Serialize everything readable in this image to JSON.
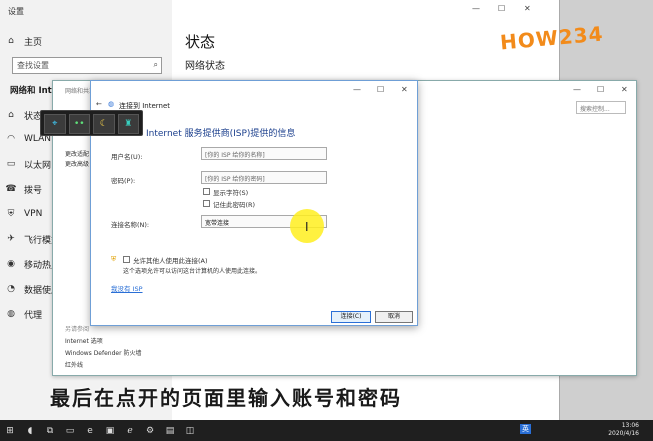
{
  "settings": {
    "title": "设置",
    "home": "主页",
    "search_placeholder": "查找设置",
    "section": "网络和 Internet",
    "nav": [
      {
        "label": "状态",
        "icon": "home-icon"
      },
      {
        "label": "WLAN",
        "icon": "wifi-icon"
      },
      {
        "label": "以太网",
        "icon": "ethernet-icon"
      },
      {
        "label": "拨号",
        "icon": "dialup-icon"
      },
      {
        "label": "VPN",
        "icon": "vpn-icon"
      },
      {
        "label": "飞行模式",
        "icon": "airplane-icon"
      },
      {
        "label": "移动热点",
        "icon": "hotspot-icon"
      },
      {
        "label": "数据使用量",
        "icon": "data-usage-icon"
      },
      {
        "label": "代理",
        "icon": "proxy-icon"
      }
    ],
    "heading": "状态",
    "subheading": "网络状态"
  },
  "nsc": {
    "title": "网络和共享中心",
    "search_placeholder": "搜索控制...",
    "left_links": [
      "更改适配",
      "更改高级"
    ],
    "see_also_title": "另请参阅",
    "see_also": [
      "Internet 选项",
      "Windows Defender 防火墙",
      "红外线"
    ]
  },
  "dialog": {
    "title": "连接到 Internet",
    "heading": "Internet 服务提供商(ISP)提供的信息",
    "username_label": "用户名(U):",
    "username_placeholder": "[你的 ISP 给你的名称]",
    "password_label": "密码(P):",
    "password_placeholder": "[你的 ISP 给你的密码]",
    "show_chars": "显示字符(S)",
    "remember_pwd": "记住此密码(R)",
    "conn_name_label": "连接名称(N):",
    "conn_name_value": "宽带连接",
    "allow_others": "允许其他人使用此连接(A)",
    "allow_others_desc": "这个选项允许可以访问这台计算机的人使用此连接。",
    "no_isp_link": "我没有 ISP",
    "connect_button": "连接(C)",
    "cancel_button": "取消"
  },
  "toolbar": {
    "buttons": [
      "pointer-icon",
      "dots-icon",
      "moon-icon",
      "brush-icon"
    ]
  },
  "subtitle": "最后在点开的页面里输入账号和密码",
  "logo": "HOW234",
  "taskbar": {
    "clock_time": "13:06",
    "clock_date": "2020/4/16",
    "ime": "英"
  },
  "colors": {
    "accent": "#2a6fd6",
    "highlight": "#ffee1e",
    "logo": "#f28b1b"
  }
}
